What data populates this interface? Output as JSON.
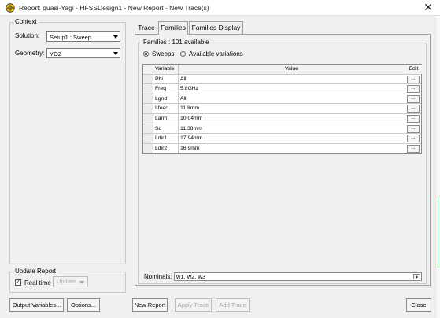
{
  "window": {
    "title": "Report: quasi-Yagi - HFSSDesign1 - New Report - New Trace(s)"
  },
  "context": {
    "group_label": "Context",
    "solution_label": "Solution:",
    "solution_value": "Setup1 : Sweep",
    "geometry_label": "Geometry:",
    "geometry_value": "YOZ"
  },
  "tabs": [
    {
      "label": "Trace"
    },
    {
      "label": "Families"
    },
    {
      "label": "Families Display"
    }
  ],
  "families": {
    "group_label": "Families : 101 available",
    "radio_sweeps": "Sweeps",
    "radio_variations": "Available variations",
    "columns": {
      "variable": "Variable",
      "value": "Value",
      "edit": "Edit"
    },
    "edit_button": "...",
    "rows": [
      {
        "variable": "Phi",
        "value": "All"
      },
      {
        "variable": "Freq",
        "value": "5.8GHz"
      },
      {
        "variable": "Lgnd",
        "value": "All"
      },
      {
        "variable": "Lfeed",
        "value": "11.8mm"
      },
      {
        "variable": "Larm",
        "value": "10.04mm"
      },
      {
        "variable": "Sd",
        "value": "11.38mm"
      },
      {
        "variable": "Ldir1",
        "value": "17.94mm"
      },
      {
        "variable": "Ldir2",
        "value": "16.9mm"
      }
    ],
    "nominals_label": "Nominals:",
    "nominals_value": "w1, w2, w3"
  },
  "update_report": {
    "group_label": "Update Report",
    "realtime_label": "Real time",
    "realtime_checked": true,
    "update_button": "Update"
  },
  "buttons": {
    "output_variables": "Output Variables...",
    "options": "Options...",
    "new_report": "New Report",
    "apply_trace": "Apply Trace",
    "add_trace": "Add Trace",
    "close": "Close"
  },
  "colors": {
    "window_bg": "#f0f0f0",
    "accent_green": "#3aa65a"
  },
  "icons": {
    "app": "hfss-logo-icon",
    "close": "close-icon",
    "dropdown": "chevron-down-icon"
  }
}
